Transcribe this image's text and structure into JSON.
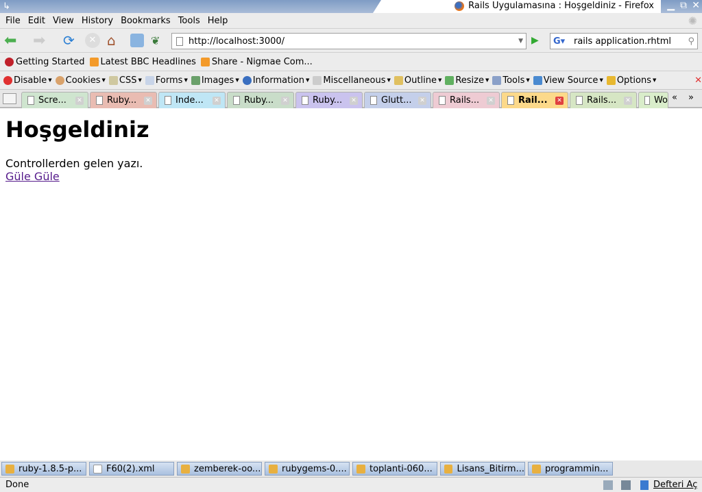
{
  "window": {
    "title": "Rails Uygulamasına : Hoşgeldiniz - Firefox"
  },
  "menu": [
    "File",
    "Edit",
    "View",
    "History",
    "Bookmarks",
    "Tools",
    "Help"
  ],
  "nav": {
    "url": "http://localhost:3000/",
    "search": "rails application.rhtml"
  },
  "bookmarks": [
    "Getting Started",
    "Latest BBC Headlines",
    "Share - Nigmae Com..."
  ],
  "devtools": [
    "Disable",
    "Cookies",
    "CSS",
    "Forms",
    "Images",
    "Information",
    "Miscellaneous",
    "Outline",
    "Resize",
    "Tools",
    "View Source",
    "Options"
  ],
  "tabs": [
    {
      "label": "Scre...",
      "color": "#cfe5cf"
    },
    {
      "label": "Ruby...",
      "color": "#e9bcb2"
    },
    {
      "label": "Inde...",
      "color": "#bfe6f5"
    },
    {
      "label": "Ruby...",
      "color": "#c9ddc9"
    },
    {
      "label": "Ruby...",
      "color": "#cac3ee"
    },
    {
      "label": "Glutt...",
      "color": "#c4cfea"
    },
    {
      "label": "Rails...",
      "color": "#eecbd3"
    },
    {
      "label": "Rail...",
      "color": "#fcd98a",
      "active": true
    },
    {
      "label": "Rails...",
      "color": "#d6e6c4"
    },
    {
      "label": "Wo",
      "color": "#d9edca"
    }
  ],
  "page": {
    "heading": "Hoşgeldiniz",
    "text": "Controllerden gelen yazı.",
    "link": "Güle Güle"
  },
  "taskbar": [
    "ruby-1.8.5-p...",
    "F60(2).xml",
    "zemberek-oo...",
    "rubygems-0....",
    "toplanti-060...",
    "Lisans_Bitirm...",
    "programmin..."
  ],
  "status": {
    "text": "Done",
    "notebook": "Defteri Aç"
  }
}
